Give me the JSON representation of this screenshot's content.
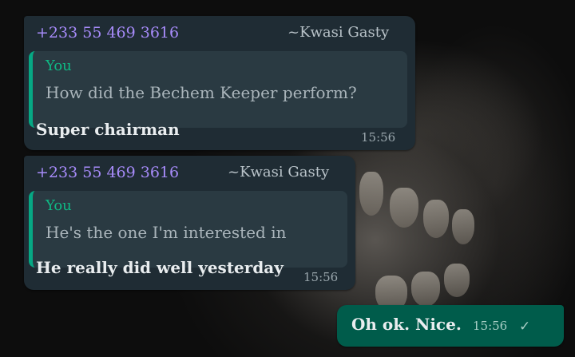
{
  "messages": [
    {
      "sender_phone": "+233 55 469 3616",
      "sender_name": "~Kwasi Gasty",
      "quote_author": "You",
      "quote_text": "How did the Bechem Keeper perform?",
      "text": "Super chairman",
      "time": "15:56"
    },
    {
      "sender_phone": "+233 55 469 3616",
      "sender_name": "~Kwasi Gasty",
      "quote_author": "You",
      "quote_text": "He's the one I'm interested in",
      "text": "He really did well yesterday",
      "time": "15:56"
    }
  ],
  "outgoing": {
    "text": "Oh ok. Nice.",
    "time": "15:56",
    "status_icon": "single-check-icon"
  },
  "colors": {
    "incoming_bubble": "#1f2c34",
    "outgoing_bubble": "#005c4b",
    "sender_phone": "#a78bfa",
    "quote_bar": "#06a884"
  }
}
